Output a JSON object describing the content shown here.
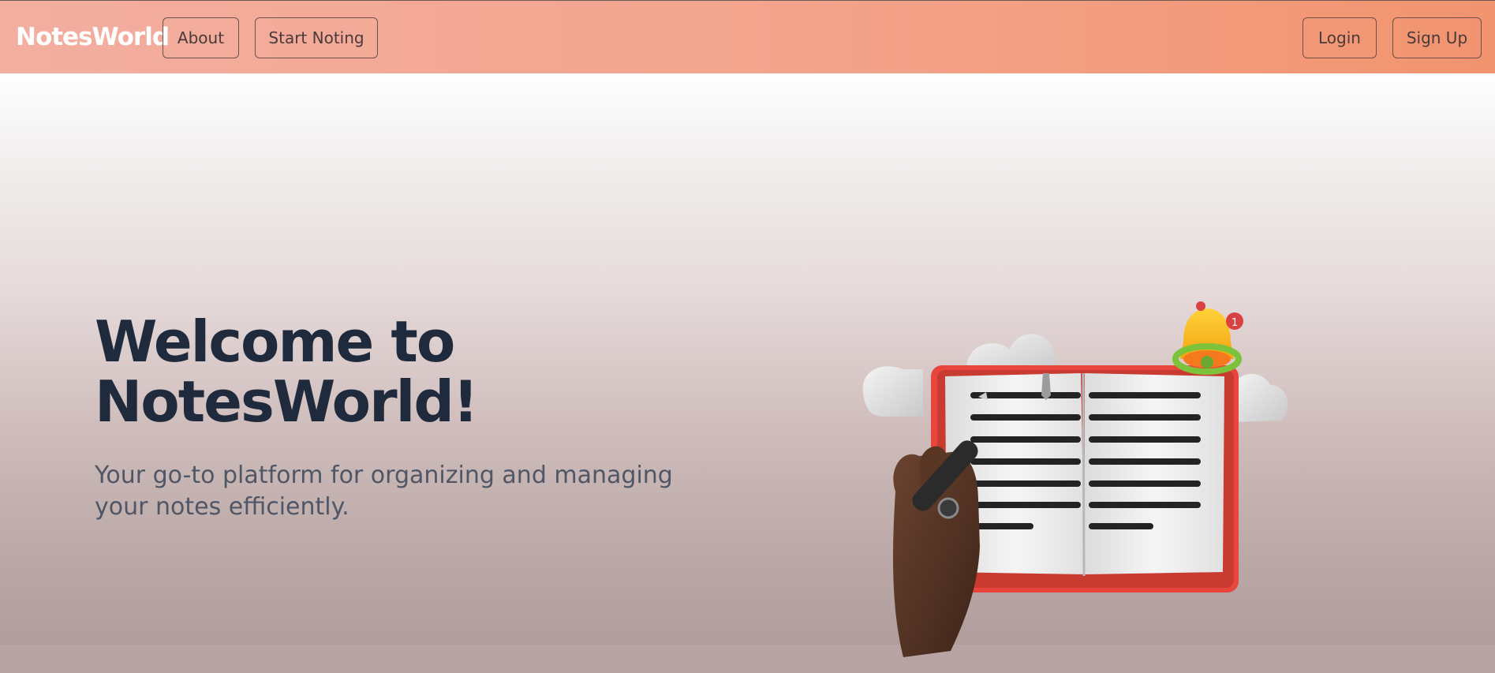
{
  "nav": {
    "brand": "NotesWorld",
    "about_label": "About",
    "start_label": "Start Noting",
    "login_label": "Login",
    "signup_label": "Sign Up"
  },
  "hero": {
    "title": "Welcome to NotesWorld!",
    "subtitle": "Your go-to platform for organizing and managing your notes efficiently."
  },
  "illustration": {
    "icon": "notebook-writing-illustration"
  },
  "colors": {
    "nav_gradient_start": "#f3aea0",
    "nav_gradient_end": "#f2946f",
    "title_color": "#1f2a3c",
    "notebook_red": "#e8463c"
  }
}
